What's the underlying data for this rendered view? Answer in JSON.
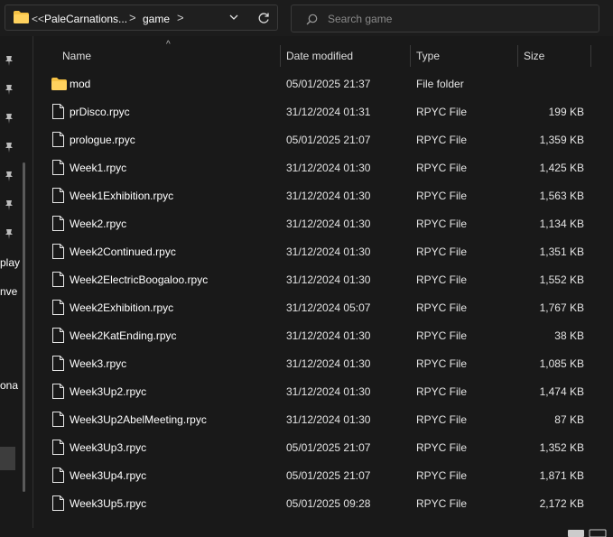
{
  "address_bar": {
    "overflow": "<<",
    "crumbs": [
      "PaleCarnations...",
      "game"
    ],
    "sep": ">"
  },
  "search": {
    "placeholder": "Search game"
  },
  "nav_pane": {
    "pins": 7,
    "visible_text": [
      "play",
      "nve",
      "ona"
    ]
  },
  "columns": {
    "name": "Name",
    "date": "Date modified",
    "type": "Type",
    "size": "Size"
  },
  "files": [
    {
      "name": "mod",
      "date": "05/01/2025 21:37",
      "type": "File folder",
      "size": "",
      "kind": "folder"
    },
    {
      "name": "prDisco.rpyc",
      "date": "31/12/2024 01:31",
      "type": "RPYC File",
      "size": "199 KB",
      "kind": "file"
    },
    {
      "name": "prologue.rpyc",
      "date": "05/01/2025 21:07",
      "type": "RPYC File",
      "size": "1,359 KB",
      "kind": "file"
    },
    {
      "name": "Week1.rpyc",
      "date": "31/12/2024 01:30",
      "type": "RPYC File",
      "size": "1,425 KB",
      "kind": "file"
    },
    {
      "name": "Week1Exhibition.rpyc",
      "date": "31/12/2024 01:30",
      "type": "RPYC File",
      "size": "1,563 KB",
      "kind": "file"
    },
    {
      "name": "Week2.rpyc",
      "date": "31/12/2024 01:30",
      "type": "RPYC File",
      "size": "1,134 KB",
      "kind": "file"
    },
    {
      "name": "Week2Continued.rpyc",
      "date": "31/12/2024 01:30",
      "type": "RPYC File",
      "size": "1,351 KB",
      "kind": "file"
    },
    {
      "name": "Week2ElectricBoogaloo.rpyc",
      "date": "31/12/2024 01:30",
      "type": "RPYC File",
      "size": "1,552 KB",
      "kind": "file"
    },
    {
      "name": "Week2Exhibition.rpyc",
      "date": "31/12/2024 05:07",
      "type": "RPYC File",
      "size": "1,767 KB",
      "kind": "file"
    },
    {
      "name": "Week2KatEnding.rpyc",
      "date": "31/12/2024 01:30",
      "type": "RPYC File",
      "size": "38 KB",
      "kind": "file"
    },
    {
      "name": "Week3.rpyc",
      "date": "31/12/2024 01:30",
      "type": "RPYC File",
      "size": "1,085 KB",
      "kind": "file"
    },
    {
      "name": "Week3Up2.rpyc",
      "date": "31/12/2024 01:30",
      "type": "RPYC File",
      "size": "1,474 KB",
      "kind": "file"
    },
    {
      "name": "Week3Up2AbelMeeting.rpyc",
      "date": "31/12/2024 01:30",
      "type": "RPYC File",
      "size": "87 KB",
      "kind": "file"
    },
    {
      "name": "Week3Up3.rpyc",
      "date": "05/01/2025 21:07",
      "type": "RPYC File",
      "size": "1,352 KB",
      "kind": "file"
    },
    {
      "name": "Week3Up4.rpyc",
      "date": "05/01/2025 21:07",
      "type": "RPYC File",
      "size": "1,871 KB",
      "kind": "file"
    },
    {
      "name": "Week3Up5.rpyc",
      "date": "05/01/2025 09:28",
      "type": "RPYC File",
      "size": "2,172 KB",
      "kind": "file"
    }
  ],
  "colors": {
    "background": "#191919",
    "folder": "#f5c144",
    "text": "#ffffff"
  }
}
